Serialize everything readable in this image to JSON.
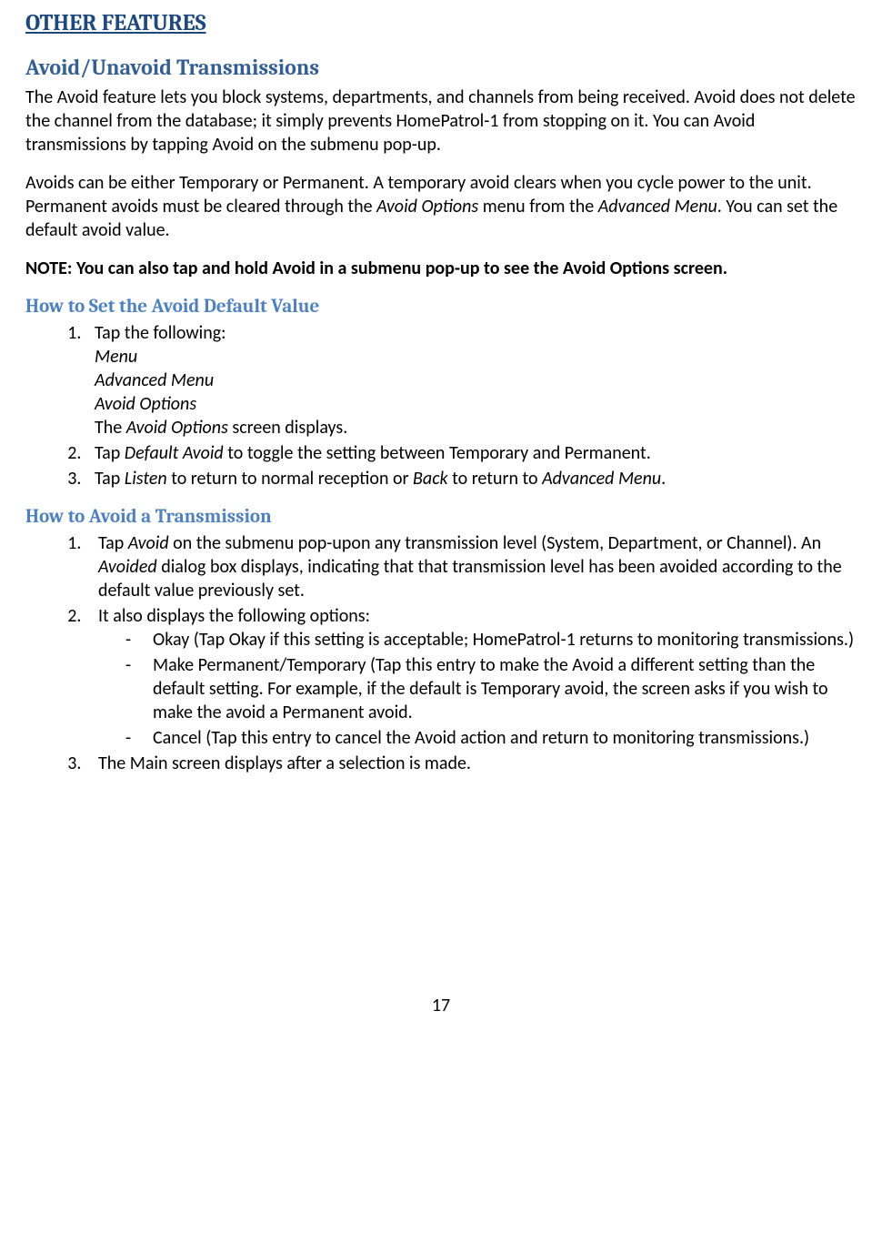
{
  "heading": "OTHER FEATURES",
  "section1": {
    "title": "Avoid/Unavoid Transmissions",
    "para1": "The Avoid feature lets you block systems, departments, and channels from being received. Avoid does not delete the channel from the database; it simply prevents HomePatrol-1 from stopping on it. You can Avoid transmissions by tapping Avoid on the submenu pop-up.",
    "para2_a": "Avoids can be either Temporary or Permanent. A temporary avoid clears when you cycle power to the unit. Permanent avoids must be cleared through the ",
    "para2_avoidoptions": "Avoid Options",
    "para2_b": " menu from the ",
    "para2_advmenu": "Advanced Menu",
    "para2_c": ". You can set the default avoid value.",
    "note": "NOTE:  You can also tap and hold Avoid in a submenu pop-up to see the Avoid Options screen."
  },
  "section2": {
    "title": "How to Set the Avoid Default Value",
    "step1_intro": "Tap the following:",
    "step1_menu": "Menu",
    "step1_advmenu": "Advanced Menu",
    "step1_avoidopts": "Avoid Options",
    "step1_end_a": "The ",
    "step1_end_b": "Avoid Options",
    "step1_end_c": " screen displays.",
    "step2_a": "Tap ",
    "step2_b": "Default Avoid",
    "step2_c": " to toggle the setting between Temporary and Permanent.",
    "step3_a": "Tap ",
    "step3_b": "Listen",
    "step3_c": " to return to normal reception or ",
    "step3_d": "Back",
    "step3_e": " to return to ",
    "step3_f": "Advanced Menu",
    "step3_g": "."
  },
  "section3": {
    "title": "How to Avoid a Transmission",
    "step1_a": "Tap ",
    "step1_b": "Avoid",
    "step1_c": " on the submenu pop-upon any transmission level (System, Department, or Channel). An ",
    "step1_d": "Avoided",
    "step1_e": " dialog box displays, indicating that that transmission level has been avoided according to the default value previously set.",
    "step2_intro": " It also displays the following options:",
    "step2_opt1": "Okay (Tap Okay if this setting is acceptable; HomePatrol-1 returns to monitoring transmissions.)",
    "step2_opt2": "Make Permanent/Temporary (Tap this entry to make the Avoid a different setting than the default setting. For example, if the default is Temporary avoid, the screen asks if you wish to make the avoid a Permanent avoid.",
    "step2_opt3": "Cancel (Tap this entry to cancel the Avoid action and return to monitoring transmissions.)",
    "step3": "The Main screen displays after a selection is made."
  },
  "pageNumber": "17"
}
